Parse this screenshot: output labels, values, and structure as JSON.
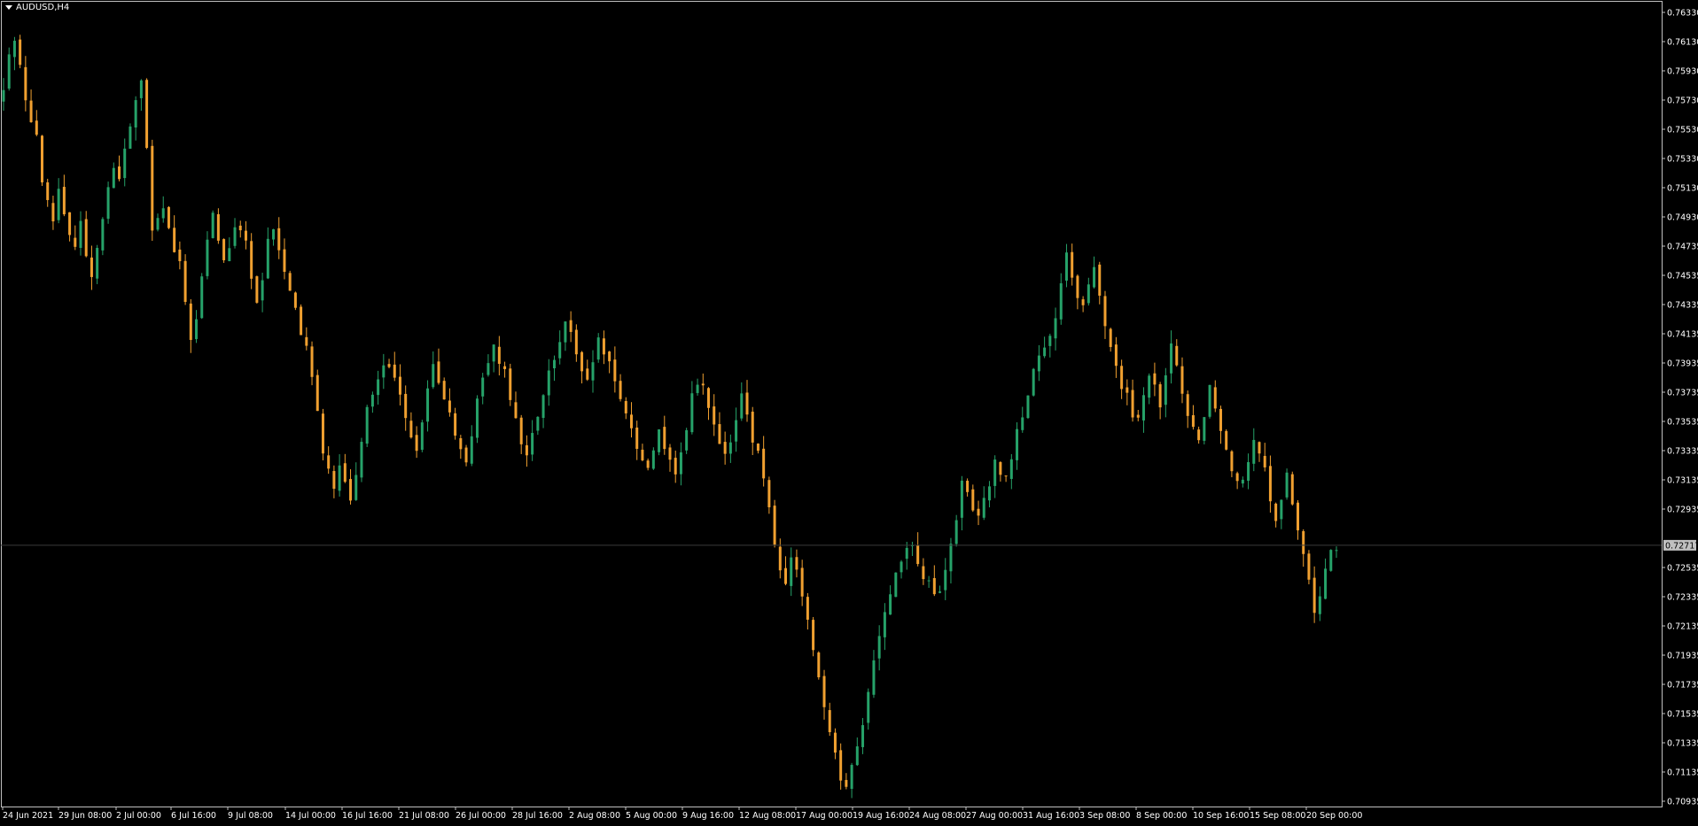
{
  "symbol_label": "AUDUSD,H4",
  "colors": {
    "background": "#000000",
    "frame": "#c0c0c0",
    "bull": "#26a269",
    "bear": "#f0a030",
    "text": "#ffffff",
    "price_line": "#3a3a3a",
    "price_tag_bg": "#c0c0c0",
    "price_tag_text": "#000000"
  },
  "chart_data": {
    "type": "candlestick",
    "title": "AUDUSD,H4",
    "ylim": [
      0.70935,
      0.7643
    ],
    "y_ticks": [
      "0.76330",
      "0.76130",
      "0.75930",
      "0.75730",
      "0.75530",
      "0.75330",
      "0.75130",
      "0.74930",
      "0.74735",
      "0.74535",
      "0.74335",
      "0.74135",
      "0.73935",
      "0.73735",
      "0.73535",
      "0.73335",
      "0.73135",
      "0.72935",
      "0.72535",
      "0.72335",
      "0.72135",
      "0.71935",
      "0.71735",
      "0.71535",
      "0.71335",
      "0.71135",
      "0.70935"
    ],
    "x_ticks": [
      "24 Jun 2021",
      "29 Jun 08:00",
      "2 Jul 00:00",
      "6 Jul 16:00",
      "9 Jul 08:00",
      "14 Jul 00:00",
      "16 Jul 16:00",
      "21 Jul 08:00",
      "26 Jul 00:00",
      "28 Jul 16:00",
      "2 Aug 08:00",
      "5 Aug 00:00",
      "9 Aug 16:00",
      "12 Aug 08:00",
      "17 Aug 00:00",
      "19 Aug 16:00",
      "24 Aug 08:00",
      "27 Aug 00:00",
      "31 Aug 16:00",
      "3 Sep 08:00",
      "8 Sep 00:00",
      "10 Sep 16:00",
      "15 Sep 08:00",
      "20 Sep 00:00"
    ],
    "current_price": "0.72717",
    "grid": false,
    "close_path": [
      0.7582,
      0.7605,
      0.7618,
      0.7598,
      0.7572,
      0.7562,
      0.7548,
      0.7518,
      0.7505,
      0.7492,
      0.7512,
      0.7498,
      0.7485,
      0.7478,
      0.7492,
      0.7468,
      0.7458,
      0.7472,
      0.7498,
      0.7512,
      0.7528,
      0.7522,
      0.7542,
      0.7558,
      0.7575,
      0.7588,
      0.7542,
      0.7485,
      0.7492,
      0.7505,
      0.7488,
      0.7472,
      0.7462,
      0.7438,
      0.7415,
      0.7428,
      0.7452,
      0.7478,
      0.7495,
      0.7482,
      0.7468,
      0.7478,
      0.7492,
      0.7488,
      0.7478,
      0.7455,
      0.7438,
      0.7452,
      0.7478,
      0.7488,
      0.7472,
      0.7462,
      0.7448,
      0.7432,
      0.7418,
      0.7405,
      0.7385,
      0.7362,
      0.7338,
      0.7322,
      0.7312,
      0.7325,
      0.7318,
      0.7302,
      0.7318,
      0.7342,
      0.7365,
      0.7375,
      0.7388,
      0.7398,
      0.7392,
      0.7385,
      0.7375,
      0.7362,
      0.7348,
      0.7338,
      0.7355,
      0.7378,
      0.7392,
      0.7385,
      0.7372,
      0.7362,
      0.7348,
      0.7338,
      0.7325,
      0.7348,
      0.7368,
      0.7385,
      0.7398,
      0.7408,
      0.7398,
      0.7388,
      0.7372,
      0.7355,
      0.7342,
      0.7332,
      0.7345,
      0.7362,
      0.7375,
      0.7388,
      0.7402,
      0.7412,
      0.7425,
      0.7418,
      0.7405,
      0.7392,
      0.7382,
      0.7398,
      0.7412,
      0.7405,
      0.7398,
      0.7385,
      0.7372,
      0.7358,
      0.7348,
      0.7338,
      0.7332,
      0.7325,
      0.7338,
      0.7348,
      0.7338,
      0.7328,
      0.7318,
      0.7332,
      0.7352,
      0.7372,
      0.7385,
      0.7378,
      0.7368,
      0.7355,
      0.7342,
      0.7332,
      0.7342,
      0.7355,
      0.7372,
      0.7362,
      0.7345,
      0.7335,
      0.7318,
      0.7298,
      0.7275,
      0.7252,
      0.7245,
      0.7262,
      0.7255,
      0.7238,
      0.7222,
      0.7202,
      0.7182,
      0.7158,
      0.7142,
      0.7128,
      0.7112,
      0.7105,
      0.7118,
      0.7132,
      0.7152,
      0.7172,
      0.7192,
      0.7212,
      0.7228,
      0.7242,
      0.7252,
      0.7262,
      0.7268,
      0.7272,
      0.7262,
      0.7252,
      0.7245,
      0.7235,
      0.7242,
      0.7255,
      0.7272,
      0.7292,
      0.7312,
      0.7305,
      0.7298,
      0.7292,
      0.7302,
      0.7315,
      0.7328,
      0.7322,
      0.7318,
      0.7332,
      0.7348,
      0.7362,
      0.7375,
      0.7388,
      0.7398,
      0.7405,
      0.7412,
      0.7425,
      0.7448,
      0.7468,
      0.7455,
      0.7442,
      0.7438,
      0.7448,
      0.7462,
      0.7445,
      0.7425,
      0.7405,
      0.7392,
      0.7382,
      0.7372,
      0.7362,
      0.7355,
      0.7372,
      0.7388,
      0.7378,
      0.7365,
      0.7385,
      0.7408,
      0.7392,
      0.7372,
      0.7362,
      0.7355,
      0.7345,
      0.7362,
      0.7378,
      0.7368,
      0.7352,
      0.7338,
      0.7325,
      0.7312,
      0.7318,
      0.7332,
      0.7345,
      0.7335,
      0.7322,
      0.7305,
      0.7288,
      0.7305,
      0.7318,
      0.7302,
      0.7282,
      0.7262,
      0.7245,
      0.7228,
      0.7238,
      0.7252,
      0.7268,
      0.7272
    ]
  }
}
